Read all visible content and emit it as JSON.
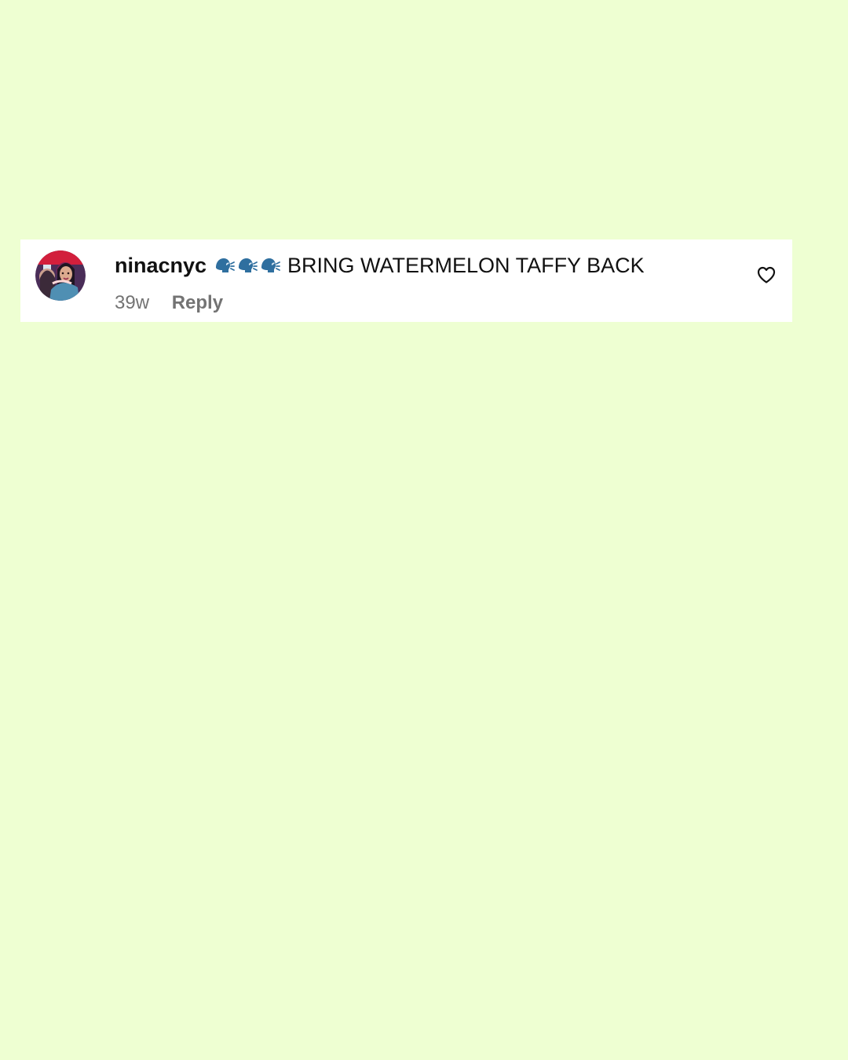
{
  "page": {
    "background_color": "#eeffd2"
  },
  "comment": {
    "avatar_icon": "profile-photo-avatar",
    "username": "ninacnyc",
    "emoji_icons": [
      "speaking-head-icon",
      "speaking-head-icon",
      "speaking-head-icon"
    ],
    "text": "BRING WATERMELON TAFFY BACK",
    "timestamp": "39w",
    "reply_label": "Reply",
    "like_icon": "heart-outline-icon"
  },
  "colors": {
    "card_background": "#ffffff",
    "primary_text": "#111111",
    "secondary_text": "#737373"
  }
}
